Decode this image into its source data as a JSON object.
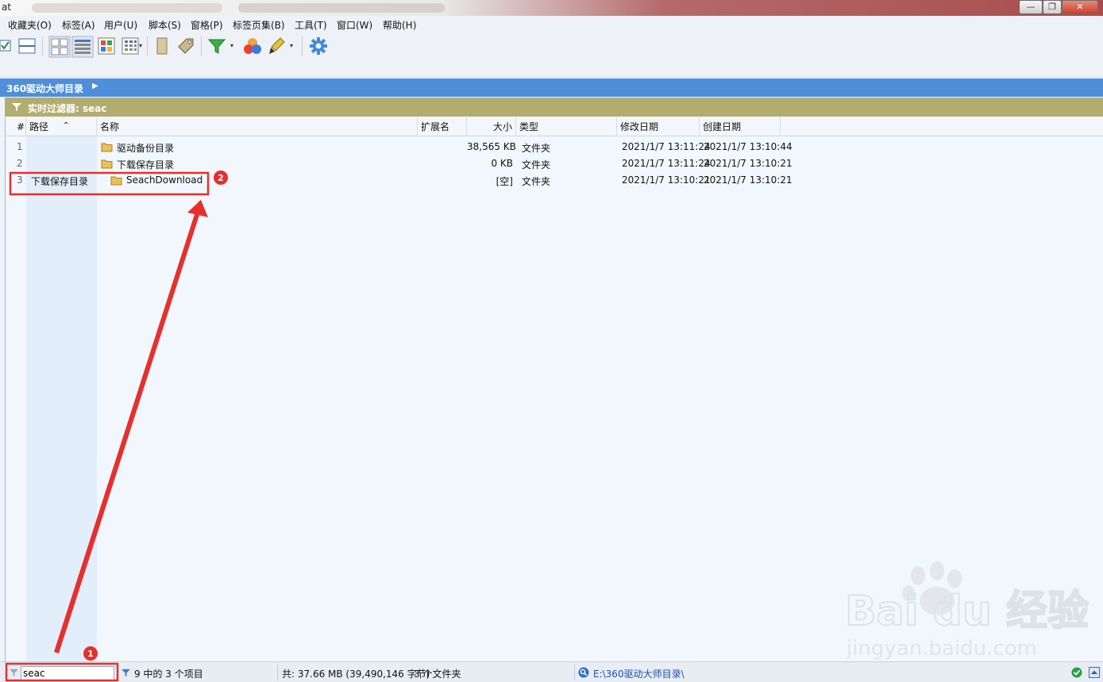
{
  "window": {
    "title": "at"
  },
  "menu": [
    "收藏夹(O)",
    "标签(A)",
    "用户(U)",
    "脚本(S)",
    "窗格(P)",
    "标签页集(B)",
    "工具(T)",
    "窗口(W)",
    "帮助(H)"
  ],
  "location": {
    "path": "360驱动大师目录"
  },
  "filter": {
    "label": "实时过滤器: seac"
  },
  "columns": {
    "num": "#",
    "path": "路径",
    "name": "名称",
    "ext": "扩展名",
    "size": "大小",
    "type": "类型",
    "modified": "修改日期",
    "created": "创建日期"
  },
  "rows": [
    {
      "num": "1",
      "path": "",
      "name": "驱动备份目录",
      "ext": "",
      "size": "38,565 KB",
      "type": "文件夹",
      "modified": "2021/1/7 13:11:24",
      "created": "2021/1/7 13:10:44"
    },
    {
      "num": "2",
      "path": "",
      "name": "下载保存目录",
      "ext": "",
      "size": "0 KB",
      "type": "文件夹",
      "modified": "2021/1/7 13:11:24",
      "created": "2021/1/7 13:10:21"
    },
    {
      "num": "3",
      "path": "下载保存目录",
      "name": "SeachDownload",
      "ext": "",
      "size": "[空]",
      "type": "文件夹",
      "modified": "2021/1/7 13:10:21",
      "created": "2021/1/7 13:10:21"
    }
  ],
  "annotations": {
    "marker1": "1",
    "marker2": "2"
  },
  "status": {
    "filter_value": "seac",
    "count": "9 中的 3 个项目",
    "total": "共: 37.66 MB (39,490,146 字节)",
    "folders": "3 个文件夹",
    "path": "E:\\360驱动大师目录\\"
  },
  "watermark": {
    "brand": "Bai du 经验",
    "url": "jingyan.baidu.com"
  },
  "colors": {
    "location_bar": "#4d8fd8",
    "filter_bar": "#b2ad6f",
    "annotation": "#e5302e"
  }
}
